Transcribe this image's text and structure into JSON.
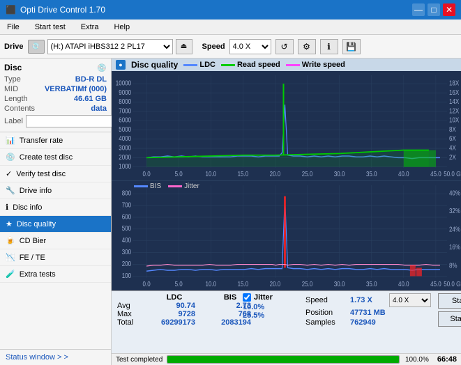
{
  "app": {
    "title": "Opti Drive Control 1.70",
    "icon": "★"
  },
  "titlebar": {
    "minimize": "—",
    "maximize": "□",
    "close": "✕"
  },
  "menu": {
    "items": [
      "File",
      "Start test",
      "Extra",
      "Help"
    ]
  },
  "toolbar": {
    "drive_label": "Drive",
    "drive_value": "(H:)  ATAPI iHBS312  2 PL17",
    "speed_label": "Speed",
    "speed_value": "4.0 X"
  },
  "disc": {
    "label": "Disc",
    "type_label": "Type",
    "type_value": "BD-R DL",
    "mid_label": "MID",
    "mid_value": "VERBATIMf (000)",
    "length_label": "Length",
    "length_value": "46.61 GB",
    "contents_label": "Contents",
    "contents_value": "data",
    "label_label": "Label",
    "label_value": ""
  },
  "sidebar": {
    "items": [
      {
        "id": "transfer-rate",
        "label": "Transfer rate",
        "active": false
      },
      {
        "id": "create-test-disc",
        "label": "Create test disc",
        "active": false
      },
      {
        "id": "verify-test-disc",
        "label": "Verify test disc",
        "active": false
      },
      {
        "id": "drive-info",
        "label": "Drive info",
        "active": false
      },
      {
        "id": "disc-info",
        "label": "Disc info",
        "active": false
      },
      {
        "id": "disc-quality",
        "label": "Disc quality",
        "active": true
      },
      {
        "id": "cd-bier",
        "label": "CD Bier",
        "active": false
      },
      {
        "id": "fe-te",
        "label": "FE / TE",
        "active": false
      },
      {
        "id": "extra-tests",
        "label": "Extra tests",
        "active": false
      }
    ],
    "status_window": "Status window > >"
  },
  "chart": {
    "title": "Disc quality",
    "legend": {
      "ldc_label": "LDC",
      "read_speed_label": "Read speed",
      "write_speed_label": "Write speed"
    },
    "top": {
      "y_max": 10000,
      "y_right_max": 18,
      "x_max": 50,
      "y_labels": [
        "10000",
        "9000",
        "8000",
        "7000",
        "6000",
        "5000",
        "4000",
        "3000",
        "2000",
        "1000",
        "0"
      ],
      "y_right_labels": [
        "18X",
        "16X",
        "14X",
        "12X",
        "10X",
        "8X",
        "6X",
        "4X",
        "2X"
      ]
    },
    "bottom": {
      "legend": {
        "bis_label": "BIS",
        "jitter_label": "Jitter"
      },
      "y_max": 800,
      "y_right_max": 40,
      "y_labels": [
        "800",
        "700",
        "600",
        "500",
        "400",
        "300",
        "200",
        "100"
      ],
      "y_right_labels": [
        "40%",
        "32%",
        "24%",
        "16%",
        "8%"
      ]
    }
  },
  "stats": {
    "columns": {
      "ldc_header": "LDC",
      "bis_header": "BIS",
      "jitter_header": "Jitter",
      "speed_header": "Speed",
      "position_header": "Position",
      "samples_header": "Samples"
    },
    "avg_label": "Avg",
    "max_label": "Max",
    "total_label": "Total",
    "ldc_avg": "90.74",
    "ldc_max": "9728",
    "ldc_total": "69299173",
    "bis_avg": "2.73",
    "bis_max": "768",
    "bis_total": "2083194",
    "jitter_avg": "10.0%",
    "jitter_max": "25.5%",
    "jitter_checked": true,
    "speed_value": "1.73 X",
    "speed_select": "4.0 X",
    "position_value": "47731 MB",
    "samples_value": "762949"
  },
  "buttons": {
    "start_full": "Start full",
    "start_part": "Start part"
  },
  "statusbar": {
    "text": "Test completed",
    "progress": 100,
    "progress_text": "100.0%",
    "time": "66:48"
  }
}
